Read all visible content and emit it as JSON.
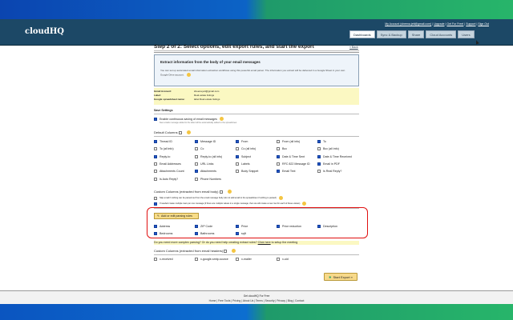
{
  "header": {
    "logo": "cloudHQ",
    "links": [
      "My Account (sheena.jett@gmail.com)",
      "Upgrade",
      "Get For Free!",
      "Support",
      "Sign Out"
    ],
    "tabs": [
      "Dashboards",
      "Sync & Backup",
      "Share",
      "Cloud Accounts",
      "Users"
    ],
    "active_tab": "Dashboards"
  },
  "title": "Step 2 of 2: Select options, edit export rules, and start the export",
  "back": "« Back",
  "info": {
    "heading": "Extract information from the body of your email messages",
    "text": "You can set up automated email information extraction workflows using this powerful email parser. The information you extract will be delivered in a Google Sheet in your own Google Drive account."
  },
  "account": {
    "gmail_label": "Gmail Account:",
    "gmail": "sheena.jett@gmail.com",
    "label_label": "Label:",
    "label": "Real estate listings",
    "sheet_label": "Google spreadsheet name:",
    "sheet": "label Real estate listings"
  },
  "save": {
    "heading": "Save Settings",
    "option": "Enable continuous saving of email messages",
    "note": "New emails message added to the label will be automatically added to the spreadsheet"
  },
  "default_columns": {
    "heading": "Default Columns",
    "items": [
      {
        "label": "Thread ID",
        "checked": true
      },
      {
        "label": "Message ID",
        "checked": true
      },
      {
        "label": "From",
        "checked": true
      },
      {
        "label": "From (all info)",
        "checked": false
      },
      {
        "label": "To",
        "checked": true
      },
      {
        "label": "To (all info)",
        "checked": false
      },
      {
        "label": "Cc",
        "checked": false
      },
      {
        "label": "Cc (all info)",
        "checked": false
      },
      {
        "label": "Bcc",
        "checked": false
      },
      {
        "label": "Bcc (all info)",
        "checked": false
      },
      {
        "label": "Reply-to",
        "checked": true
      },
      {
        "label": "Reply-to (all info)",
        "checked": false
      },
      {
        "label": "Subject",
        "checked": true
      },
      {
        "label": "Date & Time Sent",
        "checked": true
      },
      {
        "label": "Date & Time Received",
        "checked": true
      },
      {
        "label": "Email Addresses",
        "checked": false
      },
      {
        "label": "URL Links",
        "checked": false
      },
      {
        "label": "Labels",
        "checked": false
      },
      {
        "label": "RFC 822 Message ID",
        "checked": false
      },
      {
        "label": "Email in PDF",
        "checked": true
      },
      {
        "label": "Attachments Count",
        "checked": false
      },
      {
        "label": "Attachments",
        "checked": true
      },
      {
        "label": "Body Snippet",
        "checked": false
      },
      {
        "label": "Email Text",
        "checked": true
      },
      {
        "label": "Is Real Reply?",
        "checked": false
      },
      {
        "label": "Is Auto Reply?",
        "checked": false
      },
      {
        "label": "Phone Numbers",
        "checked": false
      }
    ]
  },
  "custom_body": {
    "heading": "Custom Columns (extracted from email body)",
    "skip": "Skip email if nothing can be parsed out from the email message body (do not add email to the spreadsheet if nothing is parsed)",
    "multi": "If needed create multiple rows per one message (if there are multiple values in a single message, then we will create a new row for each of these values)",
    "button": "Add or edit parsing rules",
    "items": [
      {
        "label": "Address",
        "checked": true
      },
      {
        "label": "ZIP Code",
        "checked": true
      },
      {
        "label": "Price",
        "checked": true
      },
      {
        "label": "Price reduction",
        "checked": true
      },
      {
        "label": "Description",
        "checked": true
      },
      {
        "label": "Bedrooms",
        "checked": true
      },
      {
        "label": "Bathrooms",
        "checked": true
      },
      {
        "label": "sqft",
        "checked": true
      }
    ]
  },
  "help": {
    "text": "Do you need more complex parsing? Or do you need help creating extract rules?",
    "link": "Click here",
    "after": "to setup the meeting"
  },
  "custom_headers": {
    "heading": "Custom Columns (extracted from email headers)",
    "items": [
      {
        "label": "x-received",
        "checked": false
      },
      {
        "label": "x-google-smtp-source",
        "checked": false
      },
      {
        "label": "x-mailer",
        "checked": false
      },
      {
        "label": "x-uid",
        "checked": false
      }
    ]
  },
  "start_button": "Start Export »",
  "footer": {
    "promo": "Get cloudHQ For Free",
    "links": [
      "Home",
      "Free Tools",
      "Pricing",
      "About Us",
      "Terms",
      "Security",
      "Privacy",
      "Blog",
      "Contact"
    ]
  }
}
